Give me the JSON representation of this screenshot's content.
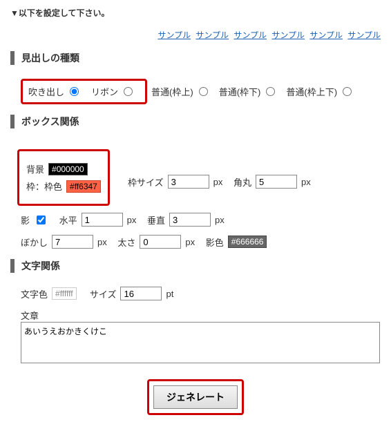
{
  "header_note": "▼以下を設定して下さい。",
  "samples": [
    "サンプル",
    "サンプル",
    "サンプル",
    "サンプル",
    "サンプル",
    "サンプル"
  ],
  "section1": {
    "title": "見出しの種類",
    "opt_balloon": "吹き出し",
    "opt_ribbon": "リボン",
    "opt_ftop": "普通(枠上)",
    "opt_fbottom": "普通(枠下)",
    "opt_fboth": "普通(枠上下)"
  },
  "section2": {
    "title": "ボックス関係",
    "bg_label": "背景",
    "bg_value": "#000000",
    "border_label": "枠：枠色",
    "border_value": "#ff6347",
    "border_size_label": "枠サイズ",
    "border_size_value": "3",
    "px": "px",
    "radius_label": "角丸",
    "radius_value": "5",
    "shadow_label": "影",
    "horiz_label": "水平",
    "horiz_value": "1",
    "vert_label": "垂直",
    "vert_value": "3",
    "blur_label": "ぼかし",
    "blur_value": "7",
    "spread_label": "太さ",
    "spread_value": "0",
    "shadow_color_label": "影色",
    "shadow_color_value": "#666666"
  },
  "section3": {
    "title": "文字関係",
    "color_label": "文字色",
    "color_value": "#ffffff",
    "size_label": "サイズ",
    "size_value": "16",
    "pt": "pt",
    "text_label": "文章",
    "text_value": "あいうえおかきくけこ"
  },
  "generate_label": "ジェネレート"
}
